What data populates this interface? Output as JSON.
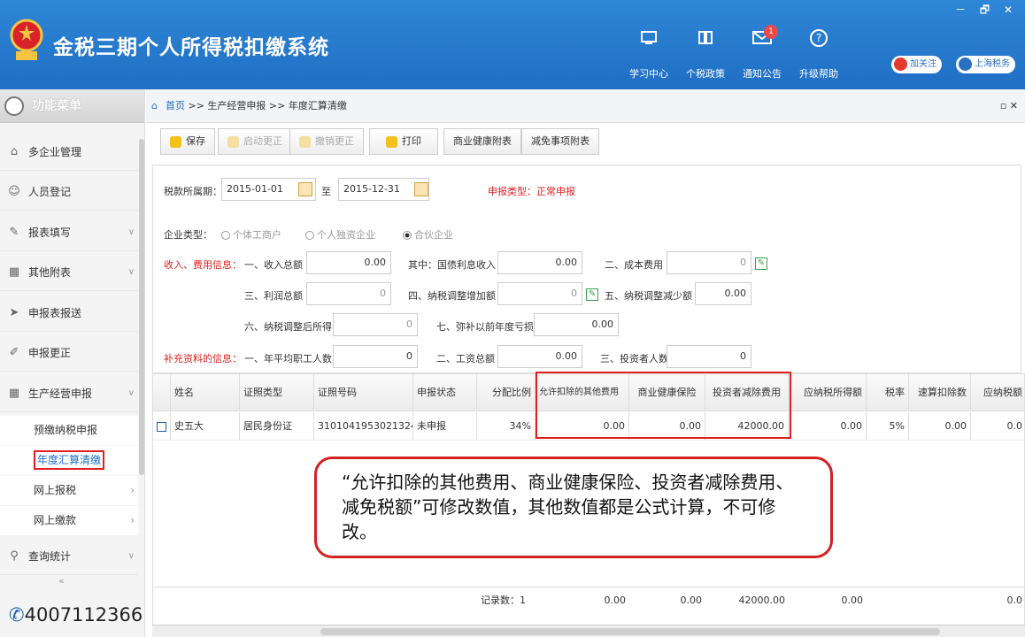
{
  "app": {
    "title": "金税三期个人所得税扣缴系统",
    "win_controls": "－ 🗗 ✕"
  },
  "topnav": [
    {
      "label": "学习中心",
      "icon": "monitor-icon"
    },
    {
      "label": "个税政策",
      "icon": "book-icon"
    },
    {
      "label": "通知公告",
      "icon": "mail-icon",
      "badge": "1"
    },
    {
      "label": "升级帮助",
      "icon": "question-icon"
    }
  ],
  "social": {
    "weibo": "加关注",
    "shanghai": "上海税务"
  },
  "sidebar": {
    "title": "功能菜单",
    "items": [
      {
        "label": "多企业管理",
        "icon": "building-icon"
      },
      {
        "label": "人员登记",
        "icon": "person-icon"
      },
      {
        "label": "报表填写",
        "icon": "edit-icon"
      },
      {
        "label": "其他附表",
        "icon": "grid-icon"
      },
      {
        "label": "申报表报送",
        "icon": "send-icon"
      },
      {
        "label": "申报更正",
        "icon": "pencil-icon"
      },
      {
        "label": "生产经营申报",
        "icon": "grid-icon"
      }
    ],
    "subitems": [
      "预缴纳税申报",
      "年度汇算清缴",
      "网上报税",
      "网上缴款"
    ],
    "query": "查询统计",
    "phone": "4007112366"
  },
  "breadcrumb": {
    "home": "首页",
    "path": ">> 生产经营申报 >> 年度汇算清缴"
  },
  "toolbar": {
    "save": "保存",
    "start_correct": "启动更正",
    "undo_correct": "撤销更正",
    "print": "打印",
    "health_attach": "商业健康附表",
    "relief_attach": "减免事项附表"
  },
  "form": {
    "period_label": "税款所属期：",
    "period_start": "2015-01-01",
    "period_to": "至",
    "period_end": "2015-12-31",
    "type_label": "申报类型：",
    "type_value": "正常申报",
    "company_type_label": "企业类型：",
    "company_types": [
      "个体工商户",
      "个人独资企业",
      "合伙企业"
    ],
    "income_label": "收入、费用信息：",
    "supp_label": "补充资料的信息：",
    "f1_label": "一、收入总额",
    "f1": "0.00",
    "f_gov_label": "其中：国债利息收入",
    "f_gov": "0.00",
    "f2_label": "二、成本费用",
    "f2": "0",
    "f3_label": "三、利润总额",
    "f3": "0",
    "f4_label": "四、纳税调整增加额",
    "f4": "0",
    "f5_label": "五、纳税调整减少额",
    "f5": "0.00",
    "f6_label": "六、纳税调整后所得",
    "f6": "0",
    "f7_label": "七、弥补以前年度亏损",
    "f7": "0.00",
    "s1_label": "一、年平均职工人数",
    "s1": "0",
    "s2_label": "二、工资总额",
    "s2": "0.00",
    "s3_label": "三、投资者人数",
    "s3": "0"
  },
  "table": {
    "headers": [
      "姓名",
      "证照类型",
      "证照号码",
      "申报状态",
      "分配比例",
      "允许扣除的其他费用",
      "商业健康保险",
      "投资者减除费用",
      "应纳税所得额",
      "税率",
      "速算扣除数",
      "应纳税额"
    ],
    "row": [
      "史五大",
      "居民身份证",
      "3101041953021324...",
      "未申报",
      "34%",
      "0.00",
      "0.00",
      "42000.00",
      "0.00",
      "5%",
      "0.00",
      "0.0"
    ],
    "footer_label": "记录数：1",
    "footer": [
      "0.00",
      "0.00",
      "42000.00",
      "0.00",
      "0.0"
    ]
  },
  "callout": "“允许扣除的其他费用、商业健康保险、投资者减除费用、减免税额”可修改数值，其他数值都是公式计算，不可修改。"
}
